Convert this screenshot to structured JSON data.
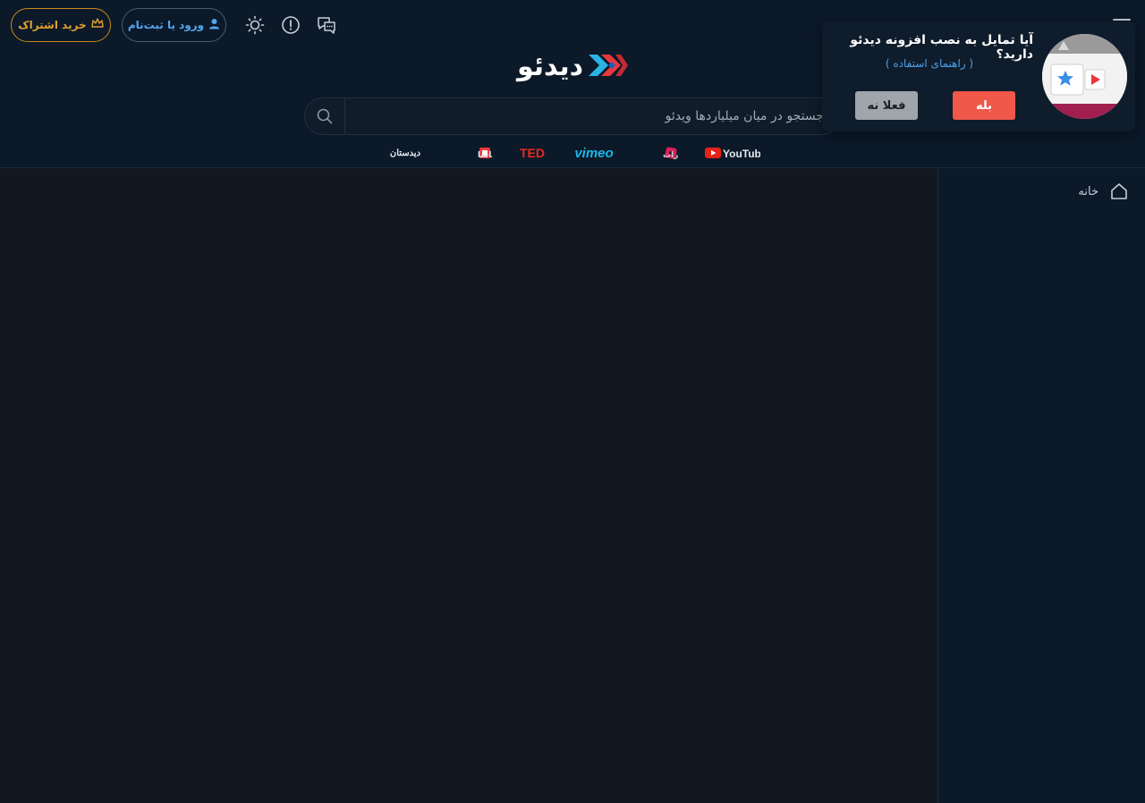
{
  "header": {
    "subscribe_label": "خرید اشتراک",
    "login_label": "ورود یا ثبت‌نام",
    "logo_text": "دیدئو",
    "icons": [
      "crown-icon",
      "user-icon",
      "sun-icon",
      "info-icon",
      "chat-icon",
      "menu-icon"
    ]
  },
  "search": {
    "placeholder": "جستجو در میان میلیاردها ویدئو"
  },
  "sources": [
    {
      "label": "YouTube"
    },
    {
      "label": "آپارات"
    },
    {
      "label": "vimeo"
    },
    {
      "label": "TED"
    },
    {
      "label": "نماشا"
    },
    {
      "label": "دیدستان"
    }
  ],
  "sidebar": {
    "items": [
      {
        "label": "خانه",
        "icon": "home-icon"
      }
    ]
  },
  "popup": {
    "title": "آیا تمایل به نصب افزونه دیدئو دارید؟",
    "guide_link": "( راهنمای استفاده )",
    "yes_label": "بله",
    "no_label": "فعلا نه"
  },
  "colors": {
    "header_bg": "#0c1929",
    "page_bg": "#121821",
    "accent_blue": "#52a8f0",
    "accent_gold": "#e0a030",
    "yes_button": "#f0584a"
  }
}
